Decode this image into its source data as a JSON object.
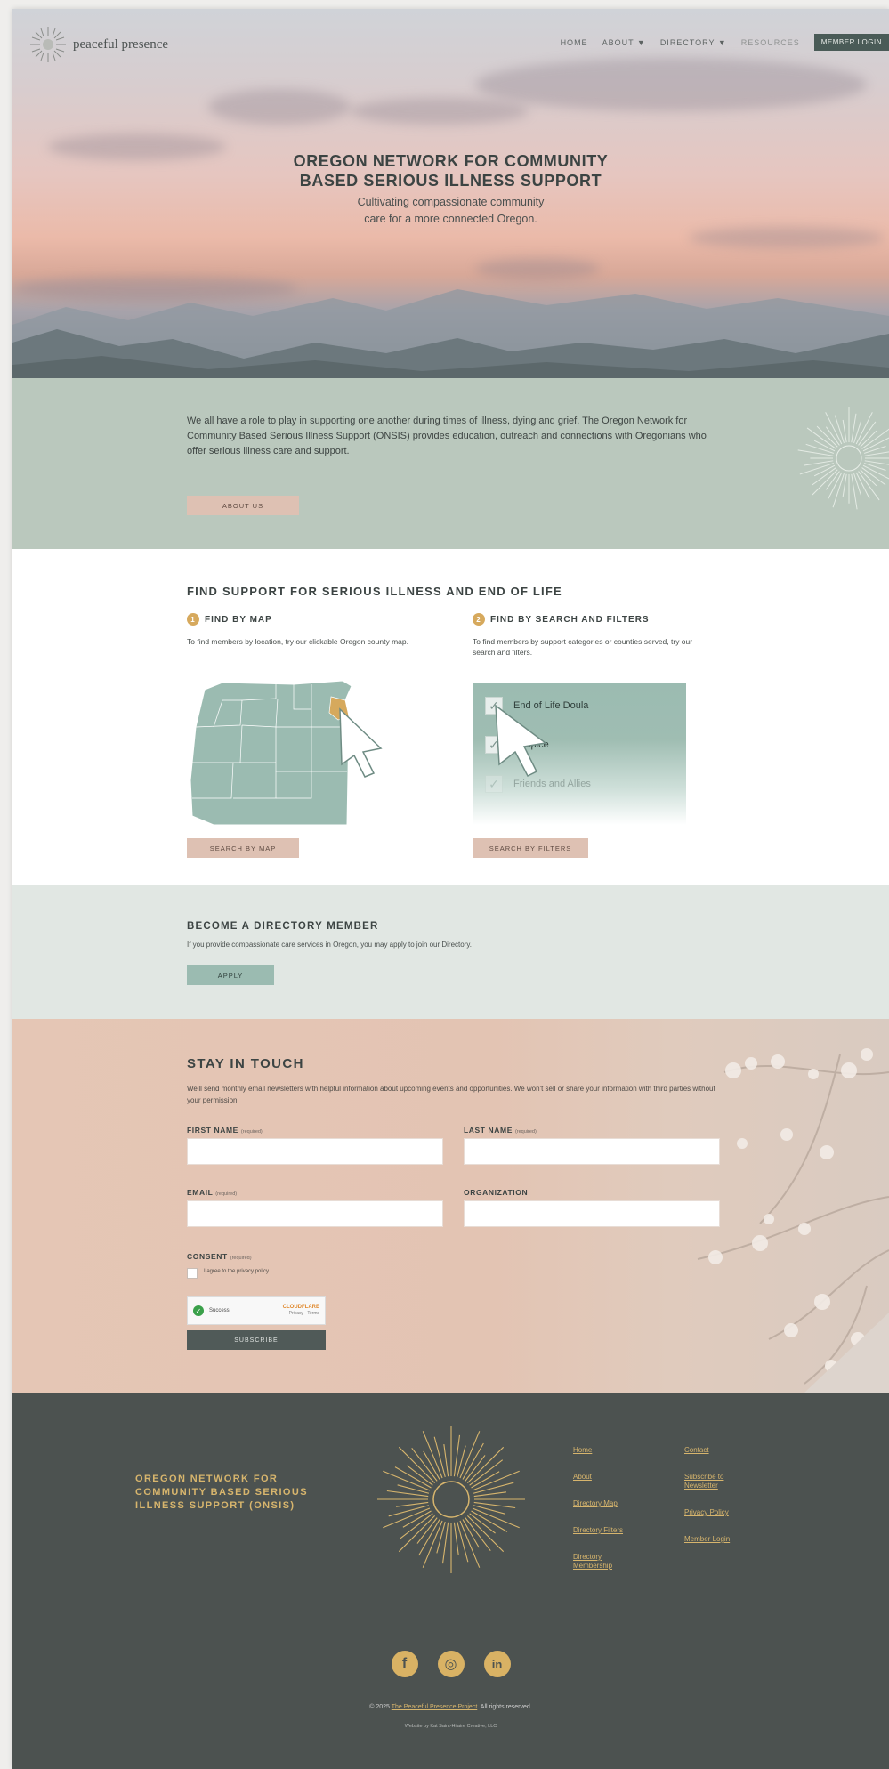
{
  "header": {
    "logo_text": "peaceful presence",
    "nav": [
      {
        "label": "HOME"
      },
      {
        "label": "ABOUT ▼"
      },
      {
        "label": "DIRECTORY ▼"
      },
      {
        "label": "RESOURCES"
      }
    ],
    "member_button": "MEMBER LOGIN"
  },
  "hero": {
    "title_line1": "OREGON NETWORK FOR COMMUNITY",
    "title_line2": "BASED SERIOUS ILLNESS SUPPORT",
    "subtitle_line1": "Cultivating compassionate community",
    "subtitle_line2": "care for a more connected Oregon."
  },
  "intro": {
    "text": "We all have a role to play in supporting one another during times of illness, dying and grief. The Oregon Network for Community Based Serious Illness Support (ONSIS) provides education, outreach and connections with Oregonians who offer serious illness care and support.",
    "button": "ABOUT US"
  },
  "find": {
    "title": "FIND SUPPORT FOR SERIOUS ILLNESS AND END OF LIFE",
    "map": {
      "number": "1",
      "heading": "FIND BY MAP",
      "desc": "To find members by location, try our clickable Oregon county map.",
      "button": "SEARCH BY MAP"
    },
    "filters": {
      "number": "2",
      "heading": "FIND BY SEARCH AND FILTERS",
      "desc": "To find members by support categories or counties served, try our search and filters.",
      "button": "SEARCH BY FILTERS",
      "options": [
        "End of Life Doula",
        "Hospice",
        "Friends and Allies"
      ]
    }
  },
  "member": {
    "title": "BECOME A DIRECTORY MEMBER",
    "desc": "If you provide compassionate care services in Oregon, you may apply to join our Directory.",
    "button": "APPLY"
  },
  "touch": {
    "title": "STAY IN TOUCH",
    "desc": "We'll send monthly email newsletters with helpful information about upcoming events and opportunities. We won't sell or share your information with third parties without your permission.",
    "fields": {
      "first_name": "FIRST NAME",
      "last_name": "LAST NAME",
      "email": "EMAIL",
      "organization": "ORGANIZATION",
      "consent": "CONSENT",
      "required": "(required)"
    },
    "consent_text": "I agree to the privacy policy.",
    "captcha_status": "Success!",
    "captcha_brand": "CLOUDFLARE",
    "captcha_sub": "Privacy · Terms",
    "submit": "SUBSCRIBE"
  },
  "footer": {
    "org": "OREGON NETWORK FOR COMMUNITY BASED SERIOUS ILLNESS SUPPORT (ONSIS)",
    "links_col1": [
      "Home",
      "About",
      "Directory Map",
      "Directory Filters",
      "Directory Membership"
    ],
    "links_col2": [
      "Contact",
      "Subscribe to Newsletter",
      "Privacy Policy",
      "Member Login"
    ],
    "social": [
      {
        "icon": "facebook-icon",
        "glyph": "f"
      },
      {
        "icon": "instagram-icon",
        "glyph": "◎"
      },
      {
        "icon": "linkedin-icon",
        "glyph": "in"
      }
    ],
    "copyright_prefix": "© 2025",
    "copyright_link": "The Peaceful Presence Project",
    "copyright_suffix": ". All rights reserved.",
    "credit": "Website by Kat Saint-Hilaire Creative, LLC"
  },
  "colors": {
    "sage": "#bac8bd",
    "sage_button": "#9bbbb1",
    "peach": "#dec1b3",
    "gold": "#d7b56d",
    "footer_bg": "#4c5250",
    "dark_button": "#4a5b57"
  }
}
